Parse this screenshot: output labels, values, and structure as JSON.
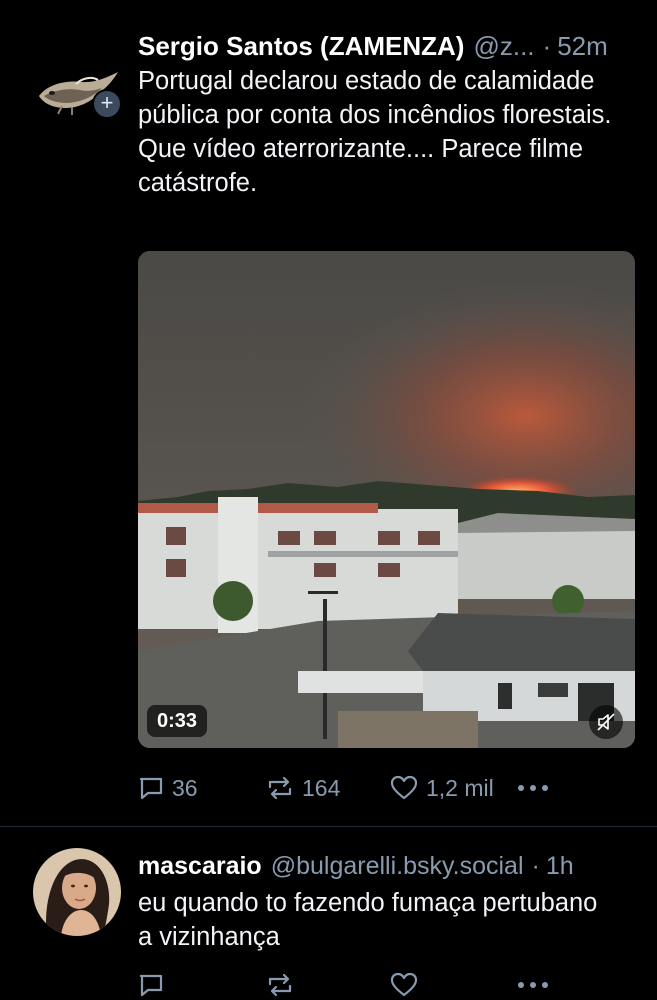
{
  "post1": {
    "display_name": "Sergio Santos (ZAMENZA)",
    "handle": "@z...",
    "separator": "·",
    "time": "52m",
    "text": "Portugal declarou estado de calamidade pública por conta dos incêndios florestais. Que vídeo aterrorizante.... Parece filme catástrofe.",
    "video": {
      "duration": "0:33",
      "muted": true
    },
    "actions": {
      "replies": "36",
      "reposts": "164",
      "likes": "1,2 mil"
    }
  },
  "post2": {
    "display_name": "mascaraio",
    "handle": "@bulgarelli.bsky.social",
    "separator": "·",
    "time": "1h",
    "text": "eu quando to fazendo fumaça pertubano a vizinhança"
  },
  "icons": {
    "reply": "speech-bubble-icon",
    "repost": "repost-arrows-icon",
    "like": "heart-icon",
    "more": "ellipsis-icon",
    "mute": "speaker-muted-icon",
    "follow": "plus-icon"
  },
  "colors": {
    "background": "#000000",
    "text": "#f2f4f7",
    "muted_text": "#8a9bb0",
    "divider": "#1f2a36"
  }
}
